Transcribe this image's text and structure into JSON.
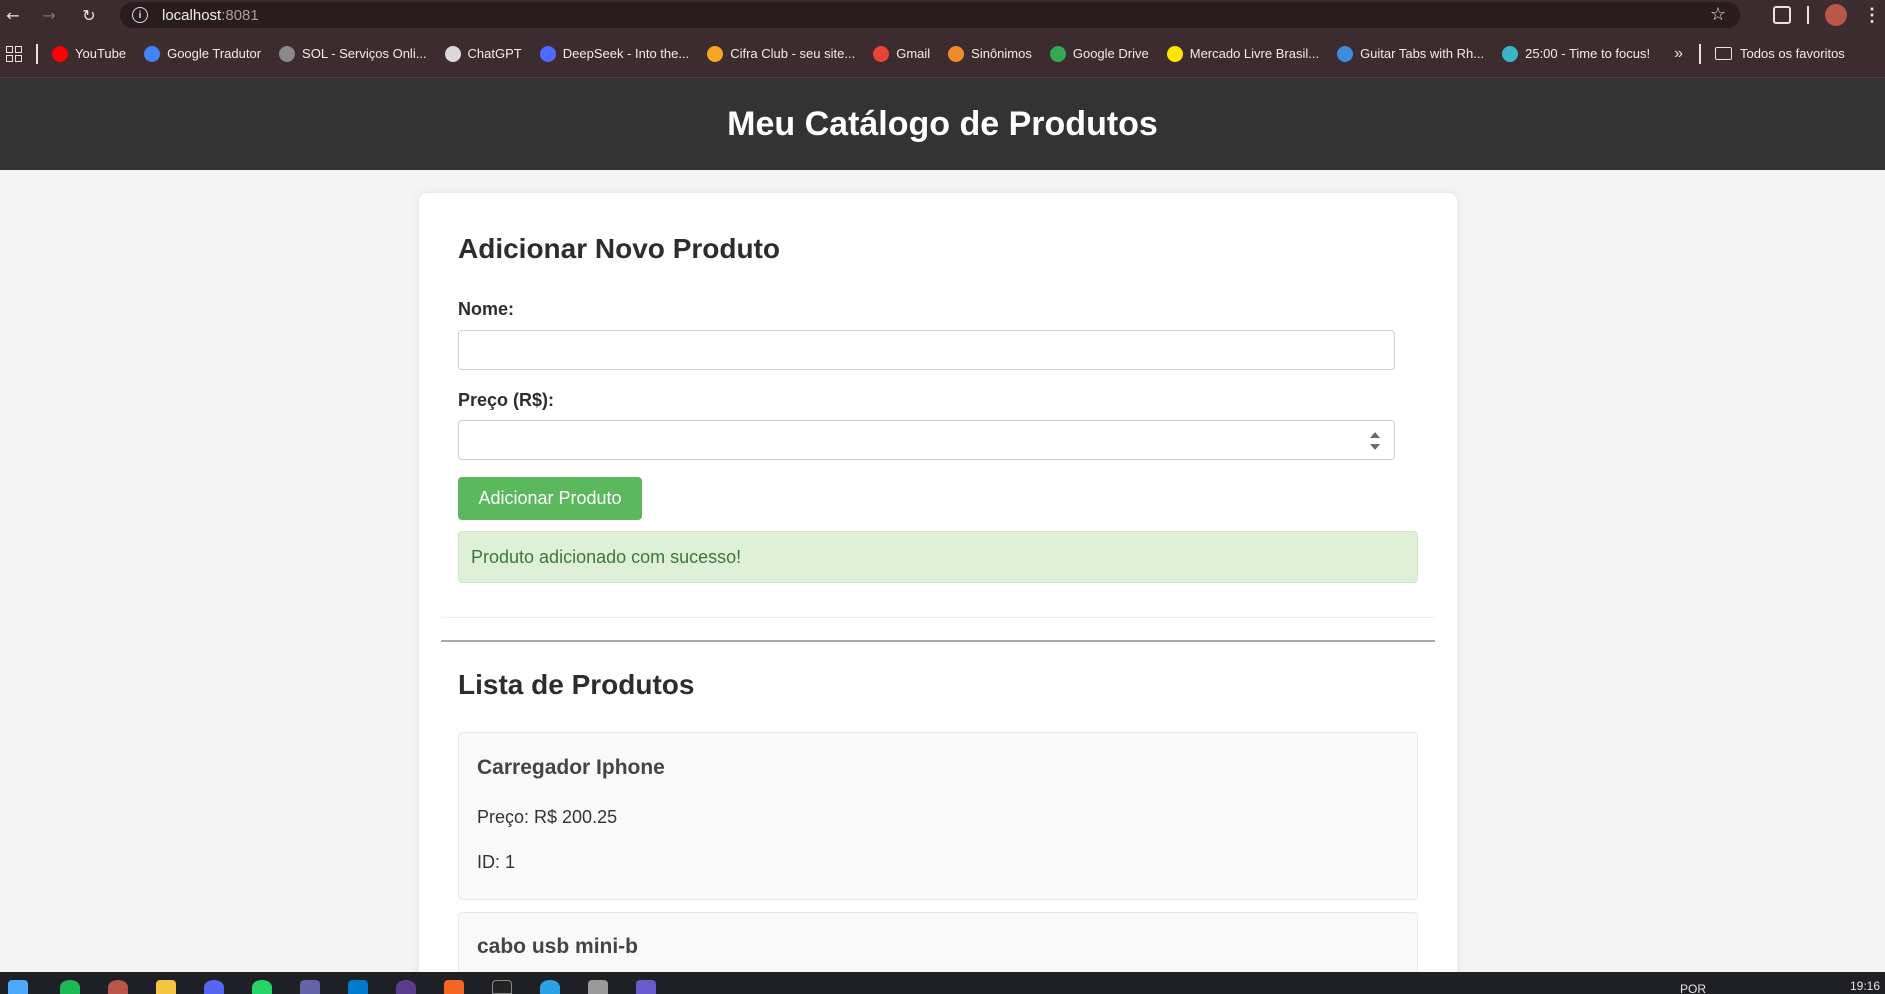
{
  "browser": {
    "url_host": "localhost",
    "url_port": ":8081",
    "nav": {
      "back": "←",
      "forward": "→",
      "reload": "↻"
    },
    "star": "☆",
    "bookmarks": [
      {
        "label": "YouTube",
        "icon": "youtube-icon",
        "color": "#ff0000"
      },
      {
        "label": "Google Tradutor",
        "icon": "translate-icon",
        "color": "#4285f4"
      },
      {
        "label": "SOL - Serviços Onli...",
        "icon": "globe-icon",
        "color": "#8a8a8a"
      },
      {
        "label": "ChatGPT",
        "icon": "chatgpt-icon",
        "color": "#d9d9d9"
      },
      {
        "label": "DeepSeek - Into the...",
        "icon": "deepseek-icon",
        "color": "#4d6bfe"
      },
      {
        "label": "Cifra Club - seu site...",
        "icon": "cifraclub-icon",
        "color": "#f5a623"
      },
      {
        "label": "Gmail",
        "icon": "gmail-icon",
        "color": "#ea4335"
      },
      {
        "label": "Sinônimos",
        "icon": "sinonimos-icon",
        "color": "#f08a2c"
      },
      {
        "label": "Google Drive",
        "icon": "drive-icon",
        "color": "#34a853"
      },
      {
        "label": "Mercado Livre Brasil...",
        "icon": "mercadolivre-icon",
        "color": "#ffe600"
      },
      {
        "label": "Guitar Tabs with Rh...",
        "icon": "guitar-tabs-icon",
        "color": "#3b8ede"
      },
      {
        "label": "25:00 - Time to focus!",
        "icon": "pomodoro-icon",
        "color": "#3ab4c9"
      }
    ],
    "more_bookmarks": "»",
    "folder_label": "Todos os favoritos"
  },
  "page": {
    "title": "Meu Catálogo de Produtos",
    "form": {
      "title": "Adicionar Novo Produto",
      "name_label": "Nome:",
      "name_value": "",
      "price_label": "Preço (R$):",
      "price_value": "",
      "submit_label": "Adicionar Produto",
      "success_message": "Produto adicionado com sucesso!"
    },
    "list": {
      "title": "Lista de Produtos",
      "products": [
        {
          "name": "Carregador Iphone",
          "price": "Preço: R$ 200.25",
          "id": "ID: 1"
        },
        {
          "name": "cabo usb mini-b"
        }
      ]
    }
  },
  "taskbar": {
    "language": "POR",
    "time": "19:16"
  }
}
